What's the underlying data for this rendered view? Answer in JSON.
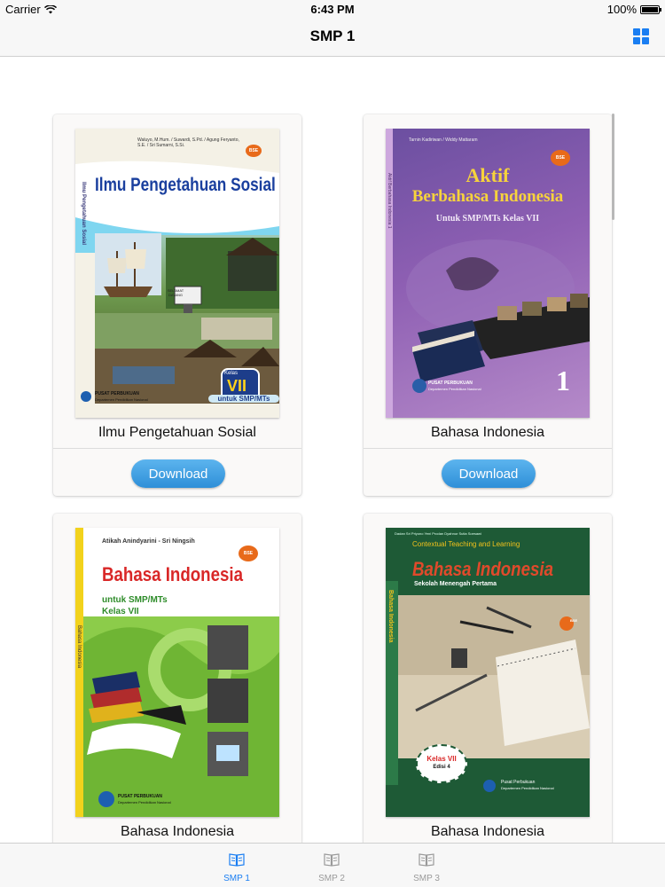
{
  "status_bar": {
    "carrier": "Carrier",
    "time": "6:43 PM",
    "battery": "100%"
  },
  "nav": {
    "title": "SMP 1",
    "grid_icon": "grid-icon"
  },
  "books": [
    {
      "title": "Ilmu Pengetahuan Sosial",
      "download_label": "Download",
      "cover": {
        "heading": "Ilmu Pengetahuan Sosial",
        "spine": "Ilmu Pengetahuan Sosial",
        "authors": "Waluyo, M.Hum. / Suwardi, S.Pd. / Agung Feryanto, S.E. / Sri Sumarni, S.Si.",
        "kelas_small": "Kelas",
        "kelas": "VII",
        "subtitle": "untuk SMP/MTs",
        "badge": "BSE",
        "publisher": "PUSAT PERBUKUAN",
        "publisher_sub": "Departemen Pendidikan Nasional",
        "sign": "SELAMAT DATANG"
      }
    },
    {
      "title": "Bahasa Indonesia",
      "download_label": "Download",
      "cover": {
        "heading_1": "Aktif",
        "heading_2": "Berbahasa Indonesia",
        "subtitle": "Untuk SMP/MTs Kelas VII",
        "number": "1",
        "badge": "BSE",
        "authors": "Tarnin Kadiriwan / Widdy Mattaram",
        "spine": "Aktif Berbahasa Indonesia 1",
        "publisher": "PUSAT PERBUKUAN",
        "publisher_sub": "Departemen Pendidikan Nasional"
      }
    },
    {
      "title": "Bahasa Indonesia",
      "cover": {
        "authors": "Atikah Anindyarini - Sri Ningsih",
        "heading": "Bahasa Indonesia",
        "subtitle_1": "untuk SMP/MTs",
        "subtitle_2": "Kelas VII",
        "badge": "BSE",
        "spine": "Bahasa Indonesia",
        "publisher": "PUSAT PERBUKUAN",
        "publisher_sub": "Departemen Pendidikan Nasional"
      }
    },
    {
      "title": "Bahasa Indonesia",
      "cover": {
        "authors": "Dadan Sri Priyono   Yeni Prodan   Dyahnur Sutia   Soesawi",
        "top_line": "Contextual Teaching and Learning",
        "heading": "Bahasa Indonesia",
        "subtitle": "Sekolah Menengah Pertama",
        "badge": "BSE",
        "kelas": "Kelas VII",
        "edisi": "Edisi 4",
        "spine": "Bahasa Indonesia",
        "publisher": "Pusat Perbukuan",
        "publisher_sub": "Departemen Pendidikan Nasional"
      }
    }
  ],
  "tabs": [
    {
      "label": "SMP 1",
      "icon": "book-icon",
      "active": true
    },
    {
      "label": "SMP 2",
      "icon": "book-icon",
      "active": false
    },
    {
      "label": "SMP 3",
      "icon": "book-icon",
      "active": false
    }
  ],
  "colors": {
    "accent": "#1a7ef2",
    "download_button": "#3a9be0",
    "cover_1_band": "#7fd6f0",
    "cover_2_purple": "#8e5fb3",
    "cover_3_green": "#7cbf3a",
    "cover_4_green": "#1e5a36"
  }
}
